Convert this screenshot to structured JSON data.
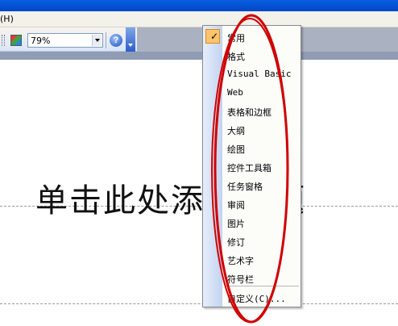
{
  "menubar": {
    "fragment": "(H)"
  },
  "toolbar": {
    "zoom_value": "79%",
    "help_label": "?"
  },
  "slide": {
    "title_text": "单击此处添加标题"
  },
  "context_menu": {
    "items": [
      {
        "label": "常用",
        "checked": true
      },
      {
        "label": "格式",
        "checked": false
      },
      {
        "label": "Visual Basic",
        "checked": false
      },
      {
        "label": "Web",
        "checked": false
      },
      {
        "label": "表格和边框",
        "checked": false
      },
      {
        "label": "大纲",
        "checked": false
      },
      {
        "label": "绘图",
        "checked": false
      },
      {
        "label": "控件工具箱",
        "checked": false
      },
      {
        "label": "任务窗格",
        "checked": false
      },
      {
        "label": "审阅",
        "checked": false
      },
      {
        "label": "图片",
        "checked": false
      },
      {
        "label": "修订",
        "checked": false
      },
      {
        "label": "艺术字",
        "checked": false
      },
      {
        "label": "符号栏",
        "checked": false
      }
    ],
    "customize_label": "自定义(C)...",
    "check_glyph": "✓"
  },
  "colors": {
    "annotation": "#d00000",
    "menu_check_bg": "#ffc46b",
    "titlebar": "#0a5fe0"
  }
}
